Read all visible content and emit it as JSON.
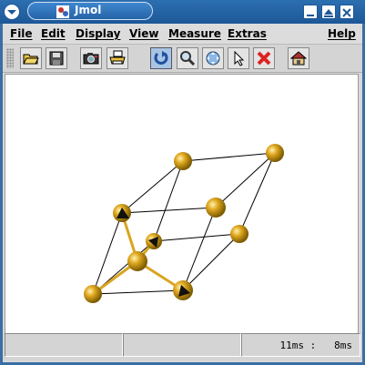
{
  "window": {
    "title": "Jmol"
  },
  "menu": [
    "File",
    "Edit",
    "Display",
    "View",
    "Measure",
    "Extras",
    "Help"
  ],
  "toolbar": {
    "buttons": [
      "open-icon",
      "save-icon",
      "camera-icon",
      "print-icon",
      "rotate-icon",
      "zoom-icon",
      "translate-icon",
      "pick-icon",
      "delete-icon",
      "home-icon"
    ],
    "active": "rotate-icon"
  },
  "status": {
    "timing": "11ms :   8ms"
  },
  "colors": {
    "atom": "#d9a520",
    "bond": "#000000",
    "vector": "#e0a818",
    "titlebar": "#2c6fb0"
  }
}
